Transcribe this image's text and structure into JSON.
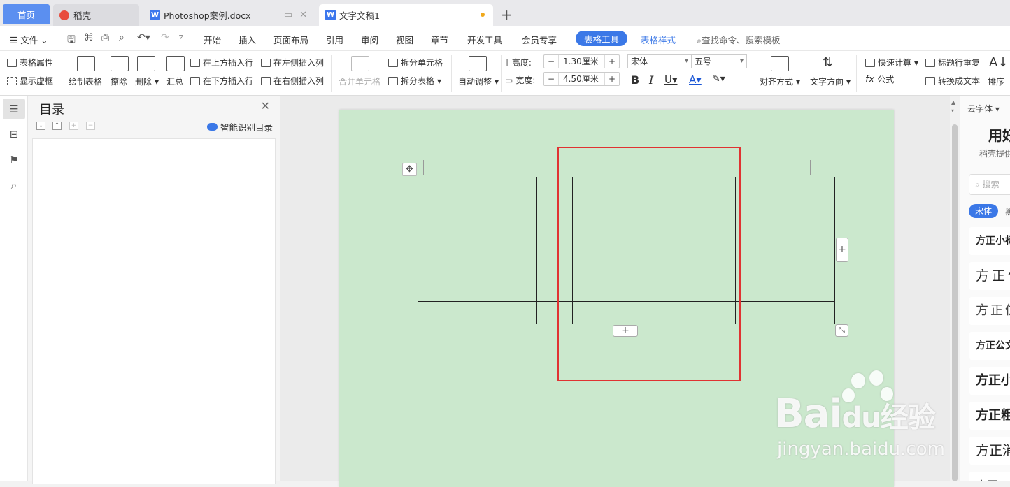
{
  "tabs": {
    "home": "首页",
    "daoke": "稻壳",
    "ps_doc": "Photoshop案例.docx",
    "current_doc": "文字文稿1"
  },
  "menu": {
    "file": "文件",
    "items": [
      "开始",
      "插入",
      "页面布局",
      "引用",
      "审阅",
      "视图",
      "章节",
      "开发工具",
      "会员专享"
    ],
    "active": "表格工具",
    "table_style": "表格样式",
    "search": "查找命令、搜索模板"
  },
  "ribbon": {
    "table_props": "表格属性",
    "show_gridlines": "显示虚框",
    "draw_table": "绘制表格",
    "erase": "擦除",
    "delete": "删除",
    "summary": "汇总",
    "insert_above": "在上方插入行",
    "insert_below": "在下方插入行",
    "insert_left": "在左侧插入列",
    "insert_right": "在右侧插入列",
    "merge_cells": "合并单元格",
    "split_cells": "拆分单元格",
    "split_table": "拆分表格",
    "auto_adjust": "自动调整",
    "height_label": "高度:",
    "height_value": "1.30厘米",
    "width_label": "宽度:",
    "width_value": "4.50厘米",
    "font_name": "宋体",
    "font_size": "五号",
    "align": "对齐方式",
    "text_dir": "文字方向",
    "quick_calc": "快速计算",
    "formula": "公式",
    "title_repeat": "标题行重复",
    "to_text": "转换成文本",
    "sort": "排序"
  },
  "toc": {
    "title": "目录",
    "smart": "智能识别目录"
  },
  "right_panel": {
    "cloud_font": "云字体",
    "heading": "用好",
    "sub": "稻壳提供",
    "search": "搜索",
    "tag_active": "宋体",
    "tag_next": "黑",
    "fonts": [
      "方正小标",
      "方正仿",
      "方正仿",
      "方正公文",
      "方正小",
      "方正粗",
      "方正消",
      "方正"
    ]
  },
  "watermark": {
    "brand": "Bai",
    "brand2": "经验",
    "brand_du": "du",
    "url": "jingyan.baidu.com"
  }
}
